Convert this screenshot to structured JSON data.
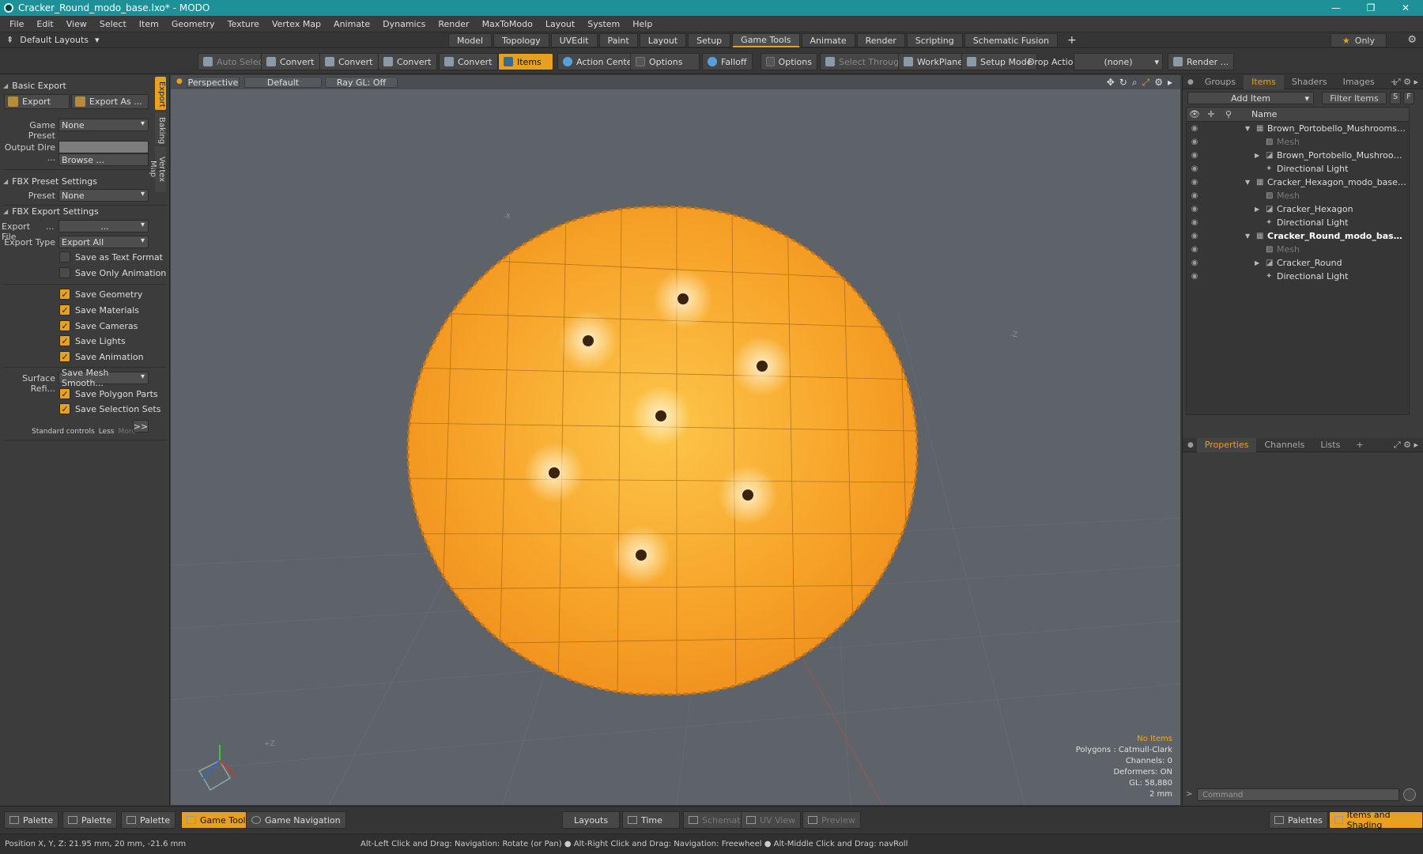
{
  "window": {
    "title": "Cracker_Round_modo_base.lxo* - MODO",
    "minimize": "—",
    "maximize": "❐",
    "close": "✕"
  },
  "menu": [
    "File",
    "Edit",
    "View",
    "Select",
    "Item",
    "Geometry",
    "Texture",
    "Vertex Map",
    "Animate",
    "Dynamics",
    "Render",
    "MaxToModo",
    "Layout",
    "System",
    "Help"
  ],
  "layout_bar": {
    "default_layouts": "Default Layouts",
    "tabs": [
      "Model",
      "Topology",
      "UVEdit",
      "Paint",
      "Layout",
      "Setup",
      "Game Tools",
      "Animate",
      "Render",
      "Scripting",
      "Schematic Fusion"
    ],
    "active_tab": "Game Tools",
    "add": "+",
    "only": "Only"
  },
  "toolbar": {
    "auto_select": "Auto Select",
    "convert1": "Convert",
    "convert2": "Convert",
    "convert3": "Convert",
    "convert4": "Convert",
    "items": "Items",
    "action_center": "Action Center",
    "options1": "Options",
    "falloff": "Falloff",
    "options2": "Options",
    "select_through": "Select Through",
    "workplane": "WorkPlane",
    "setup_mode": "Setup Mode",
    "drop_action_label": "Drop Action",
    "drop_action_value": "(none)",
    "render": "Render ..."
  },
  "left_panel": {
    "side_tabs": [
      "Export",
      "Baking",
      "Vertex Map"
    ],
    "basic_export": "Basic Export",
    "export_btn": "Export",
    "export_as_btn": "Export As ...",
    "game_preset_label": "Game Preset",
    "game_preset_value": "None",
    "output_dir_label": "Output Dire ...",
    "browse": "Browse ...",
    "fbx_preset_settings": "FBX Preset Settings",
    "preset_label": "Preset",
    "preset_value": "None",
    "fbx_export_settings": "FBX Export Settings",
    "export_file_label": "Export File",
    "export_file_dots": "...",
    "export_file_value": "...",
    "export_type_label": "Export Type",
    "export_type_value": "Export All",
    "save_text": "Save as Text Format",
    "save_anim_only": "Save Only Animation",
    "checks": [
      "Save Geometry",
      "Save Materials",
      "Save Cameras",
      "Save Lights",
      "Save Animation"
    ],
    "surface_ref_label": "Surface Refi...",
    "surface_ref_value": "Save Mesh Smooth...",
    "save_polygon_parts": "Save Polygon Parts",
    "save_selection_sets": "Save Selection Sets",
    "standard_controls": "Standard controls",
    "less": "Less",
    "more": "More",
    "expand": ">>"
  },
  "viewport": {
    "view": "Perspective",
    "shading": "Default",
    "raygl": "Ray GL: Off",
    "axis_labels": [
      "-X",
      "-Z",
      "+Z"
    ],
    "info": {
      "no_items": "No Items",
      "polygons": "Polygons : Catmull-Clark",
      "channels": "Channels: 0",
      "deformers": "Deformers: ON",
      "gl": "GL: 58,880",
      "scale": "2 mm"
    }
  },
  "right_panel": {
    "top_tabs": [
      "Groups",
      "Items",
      "Shaders",
      "Images"
    ],
    "active_top_tab": "Items",
    "add": "+",
    "add_item": "Add Item",
    "filter_items": "Filter Items",
    "s_btn": "S",
    "f_btn": "F",
    "name_header": "Name",
    "items": [
      {
        "label": "Brown_Portobello_Mushrooms_in_B ...",
        "indent": 0,
        "arrow": "▼",
        "kind": "scene"
      },
      {
        "label": "Mesh",
        "indent": 1,
        "arrow": "",
        "kind": "dim"
      },
      {
        "label": "Brown_Portobello_Mushrooms_in ...",
        "indent": 1,
        "arrow": "▶",
        "kind": "mesh"
      },
      {
        "label": "Directional Light",
        "indent": 1,
        "arrow": "",
        "kind": "light"
      },
      {
        "label": "Cracker_Hexagon_modo_base.lxo*",
        "indent": 0,
        "arrow": "▼",
        "kind": "scene"
      },
      {
        "label": "Mesh",
        "indent": 1,
        "arrow": "",
        "kind": "dim"
      },
      {
        "label": "Cracker_Hexagon",
        "indent": 1,
        "arrow": "▶",
        "kind": "mesh"
      },
      {
        "label": "Directional Light",
        "indent": 1,
        "arrow": "",
        "kind": "light"
      },
      {
        "label": "Cracker_Round_modo_base.lx...",
        "indent": 0,
        "arrow": "▼",
        "kind": "bold"
      },
      {
        "label": "Mesh",
        "indent": 1,
        "arrow": "",
        "kind": "dim"
      },
      {
        "label": "Cracker_Round",
        "indent": 1,
        "arrow": "▶",
        "kind": "mesh"
      },
      {
        "label": "Directional Light",
        "indent": 1,
        "arrow": "",
        "kind": "light"
      }
    ],
    "bottom_tabs": [
      "Properties",
      "Channels",
      "Lists"
    ],
    "active_bottom_tab": "Properties",
    "command_placeholder": "Command"
  },
  "bottom_bar": {
    "palette1": "Palette",
    "palette2": "Palette",
    "palette3": "Palette",
    "game_tools": "Game Tools",
    "game_navigation": "Game Navigation",
    "layouts": "Layouts",
    "time": "Time",
    "schematic": "Schematic",
    "uv_view": "UV View",
    "preview": "Preview",
    "palettes": "Palettes",
    "items_and_shading": "Items and Shading"
  },
  "status": {
    "position": "Position X, Y, Z:  21.95 mm, 20 mm, -21.6 mm",
    "hint": "Alt-Left Click and Drag: Navigation: Rotate (or Pan) ● Alt-Right Click and Drag: Navigation: Freewheel ● Alt-Middle Click and Drag: navRoll"
  },
  "colors": {
    "accent": "#e8a020",
    "title_bar": "#1e9098",
    "viewport_bg": "#5d6368",
    "cracker": "#f5a623"
  }
}
